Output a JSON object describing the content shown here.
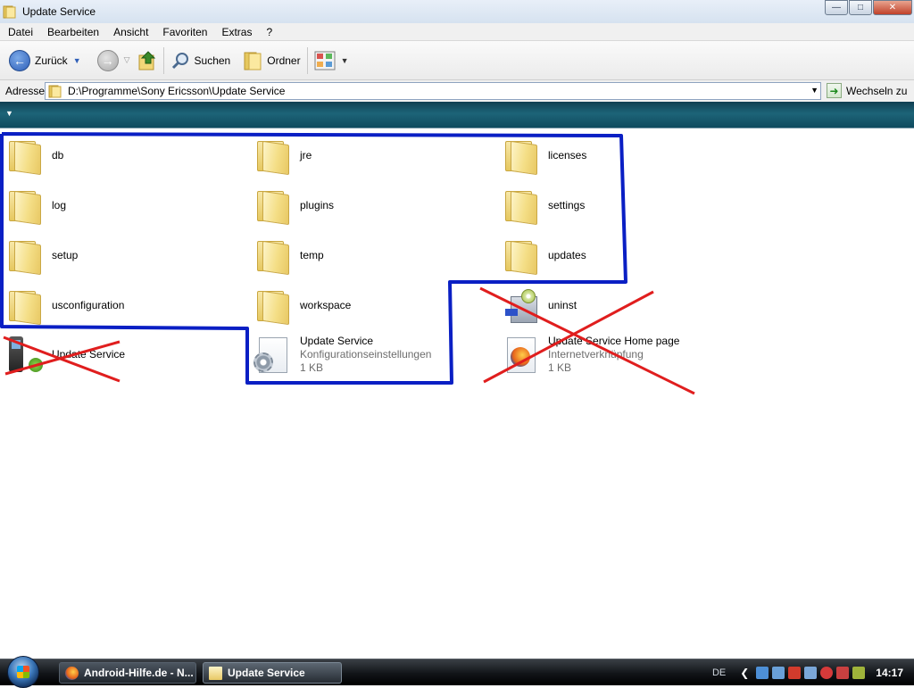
{
  "window": {
    "title": "Update Service",
    "minimize_icon": "minimize-icon",
    "maximize_icon": "maximize-icon",
    "close_icon": "close-icon"
  },
  "menu": [
    "Datei",
    "Bearbeiten",
    "Ansicht",
    "Favoriten",
    "Extras",
    "?"
  ],
  "toolbar": {
    "back_label": "Zurück",
    "search_label": "Suchen",
    "folders_label": "Ordner"
  },
  "address": {
    "label": "Adresse",
    "path": "D:\\Programme\\Sony Ericsson\\Update Service",
    "go_label": "Wechseln zu"
  },
  "files": [
    {
      "name": "db",
      "type": "folder"
    },
    {
      "name": "jre",
      "type": "folder"
    },
    {
      "name": "licenses",
      "type": "folder"
    },
    {
      "name": "log",
      "type": "folder"
    },
    {
      "name": "plugins",
      "type": "folder"
    },
    {
      "name": "settings",
      "type": "folder"
    },
    {
      "name": "setup",
      "type": "folder"
    },
    {
      "name": "temp",
      "type": "folder"
    },
    {
      "name": "updates",
      "type": "folder"
    },
    {
      "name": "usconfiguration",
      "type": "folder"
    },
    {
      "name": "workspace",
      "type": "folder"
    },
    {
      "name": "uninst",
      "type": "installer"
    },
    {
      "name": "Update Service",
      "type": "phone-app"
    },
    {
      "name": "Update Service",
      "type": "config",
      "desc": "Konfigurationseinstellungen",
      "size": "1 KB"
    },
    {
      "name": "Update Service Home page",
      "type": "shortcut",
      "desc": "Internetverknüpfung",
      "size": "1 KB"
    }
  ],
  "annotation_colors": {
    "outline": "#0a1fc4",
    "cross": "#e01e1e"
  },
  "taskbar": {
    "buttons": [
      "Android-Hilfe.de - N...",
      "Update Service"
    ],
    "language": "DE",
    "clock": "14:17"
  }
}
